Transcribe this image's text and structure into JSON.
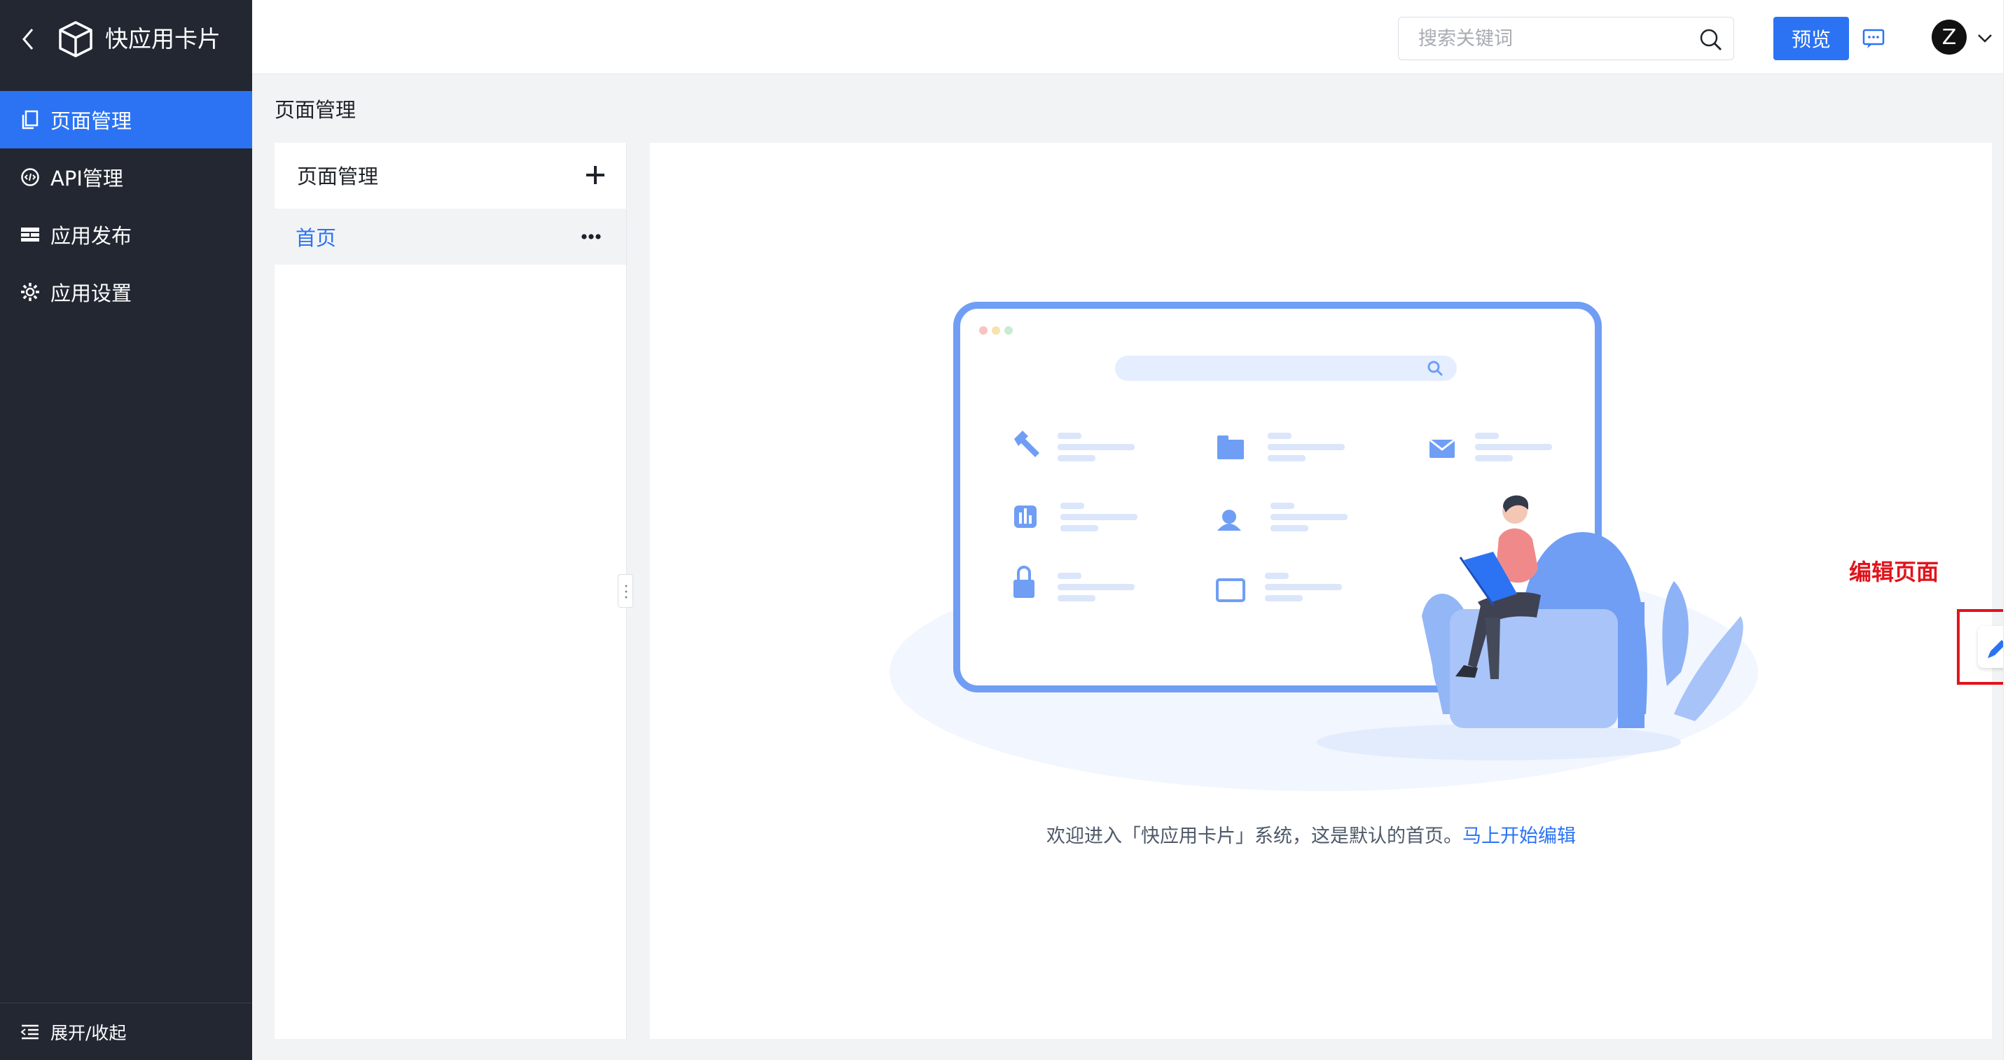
{
  "app": {
    "title": "快应用卡片"
  },
  "sidebar": {
    "items": [
      {
        "label": "页面管理",
        "icon": "page-icon",
        "active": true
      },
      {
        "label": "API管理",
        "icon": "api-icon",
        "active": false
      },
      {
        "label": "应用发布",
        "icon": "publish-icon",
        "active": false
      },
      {
        "label": "应用设置",
        "icon": "gear-icon",
        "active": false
      }
    ],
    "footer_label": "展开/收起"
  },
  "topbar": {
    "search_placeholder": "搜索关键词",
    "preview_label": "预览",
    "avatar_initial": "Z"
  },
  "page": {
    "title": "页面管理"
  },
  "pages_panel": {
    "header": "页面管理",
    "items": [
      {
        "label": "首页",
        "selected": true
      }
    ]
  },
  "main": {
    "welcome_text": "欢迎进入「快应用卡片」系统，这是默认的首页。",
    "welcome_link": "马上开始编辑"
  },
  "annotation": {
    "label": "编辑页面"
  },
  "colors": {
    "accent": "#2b73f3",
    "sidebar_bg": "#222732",
    "annotation": "#e0141c"
  }
}
